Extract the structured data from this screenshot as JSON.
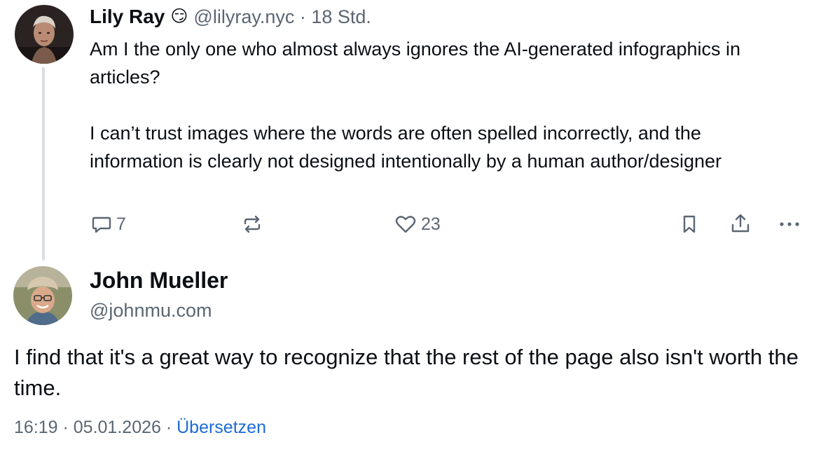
{
  "post1": {
    "display_name": "Lily Ray",
    "emoji": "😏",
    "handle_line": "@lilyray.nyc · 18 Std.",
    "paragraphs": [
      "Am I the only one who almost always ignores the AI-generated infographics in articles?",
      "I can’t trust images where the words are often spelled incorrectly, and the information is clearly not designed intentionally by a human author/designer"
    ],
    "actions": {
      "reply_count": "7",
      "like_count": "23",
      "icons": [
        "reply-icon",
        "repost-icon",
        "like-icon",
        "bookmark-icon",
        "share-icon",
        "more-icon"
      ]
    }
  },
  "post2": {
    "display_name": "John Mueller",
    "handle": "@johnmu.com",
    "text": "I find that it's a great way to recognize that the rest of the page also isn't worth the time.",
    "timestamp": "16:19 · 05.01.2026",
    "separator": " · ",
    "translate_label": "Übersetzen"
  },
  "colors": {
    "text": "#0b0f14",
    "muted": "#5b6673",
    "link": "#1c6bd6",
    "thread_line": "#d9dee4"
  }
}
